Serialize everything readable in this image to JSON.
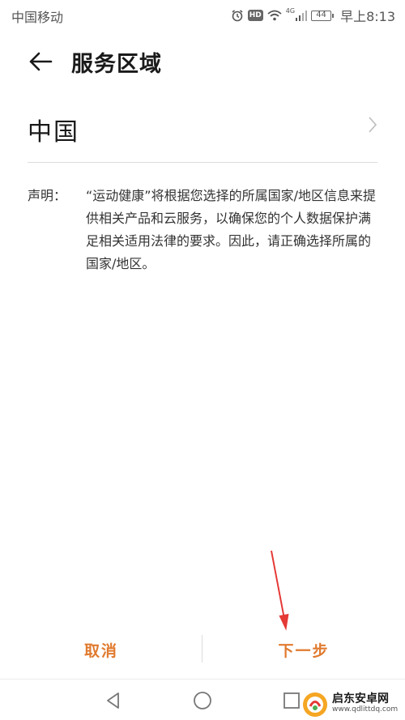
{
  "status_bar": {
    "carrier": "中国移动",
    "hd": "HD",
    "network": "4G",
    "battery": "44",
    "time": "早上8:13"
  },
  "header": {
    "title": "服务区域"
  },
  "region": {
    "value": "中国"
  },
  "notice": {
    "label": "声明：",
    "text": "“运动健康”将根据您选择的所属国家/地区信息来提供相关产品和云服务，以确保您的个人数据保护满足相关适用法律的要求。因此，请正确选择所属的国家/地区。"
  },
  "actions": {
    "cancel": "取消",
    "next": "下一步"
  },
  "watermark": {
    "title": "启东安卓网",
    "url": "www.qdlittdq.com"
  },
  "colors": {
    "accent": "#e07a2e",
    "annotation": "#e53935",
    "text": "#1a1a1a"
  }
}
